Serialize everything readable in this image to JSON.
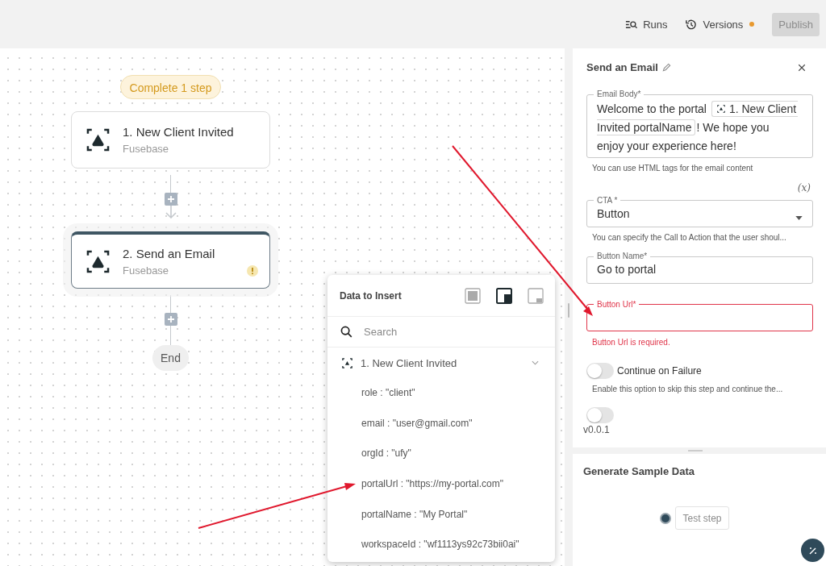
{
  "toolbar": {
    "runs": "Runs",
    "versions": "Versions",
    "versions_unsaved": true,
    "publish": {
      "label": "Publish",
      "disabled": true
    }
  },
  "canvas": {
    "status_badge": "Complete 1 step",
    "nodes": [
      {
        "title": "1. New Client Invited",
        "app": "Fusebase",
        "selected": false,
        "warning": false
      },
      {
        "title": "2. Send an Email",
        "app": "Fusebase",
        "selected": true,
        "warning": true
      }
    ],
    "end_label": "End"
  },
  "data_popup": {
    "title": "Data to Insert",
    "layouts": [
      {
        "kind": "full",
        "selected": false
      },
      {
        "kind": "corner",
        "selected": true
      },
      {
        "kind": "bottom",
        "selected": false
      }
    ],
    "search": {
      "placeholder": "Search"
    },
    "groups": [
      {
        "title": "1. New Client Invited",
        "expanded": true,
        "children": [
          "role : \"client\"",
          "email : \"user@gmail.com\"",
          "orgId : \"ufy\"",
          "portalUrl : \"https://my-portal.com\"",
          "portalName : \"My Portal\"",
          "workspaceId : \"wf1113ys92c73bii0ai\""
        ]
      }
    ]
  },
  "panel": {
    "title": "Send an Email",
    "email_body": {
      "label": "Email Body*",
      "lines": [
        [
          {
            "kind": "text",
            "text": "Welcome to the portal"
          },
          {
            "kind": "chip",
            "text": "1. New Client"
          }
        ],
        [
          {
            "kind": "chip_cont",
            "text": "Invited portalName"
          },
          {
            "kind": "text",
            "text": "! We hope you"
          }
        ],
        [
          {
            "kind": "text",
            "text": "enjoy your experience here!"
          }
        ]
      ],
      "helper": "You can use HTML tags for the email content"
    },
    "variable_toggle": "(x)",
    "cta": {
      "label": "CTA *",
      "value": "Button",
      "helper": "You can specify the Call to Action that the user shoul..."
    },
    "button_name": {
      "label": "Button Name*",
      "value": "Go to portal",
      "error": false
    },
    "button_url": {
      "label": "Button Url*",
      "error": true,
      "error_text": "Button Url is required."
    },
    "toggles": [
      {
        "label": "Continue on Failure",
        "on": false,
        "helper": "Enable this option to skip this step and continue the..."
      }
    ],
    "partial_toggle": {
      "on": false
    },
    "version": "v0.0.1"
  },
  "sample": {
    "title": "Generate Sample Data",
    "test_button": "Test step"
  }
}
